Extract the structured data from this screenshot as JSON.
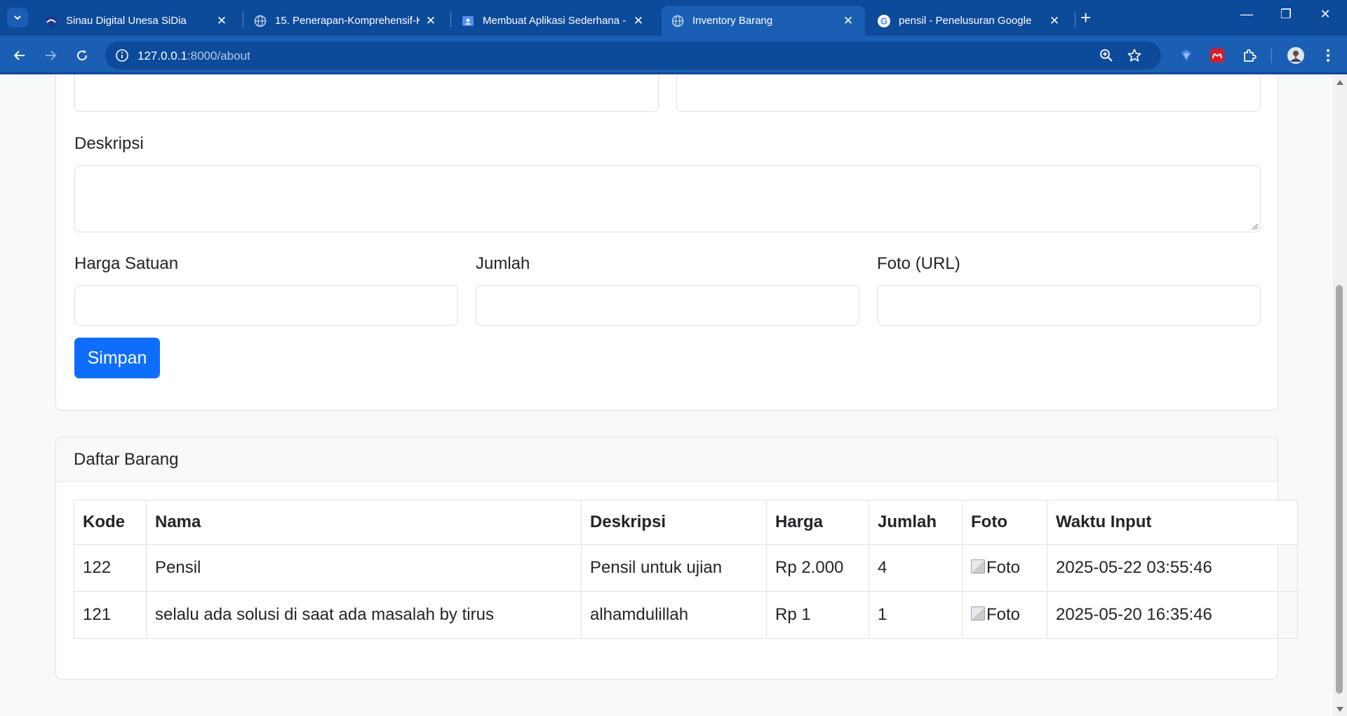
{
  "browser": {
    "tabs": [
      {
        "title": "Sinau Digital Unesa SiDia",
        "active": false
      },
      {
        "title": "15. Penerapan-Komprehensif-K",
        "active": false
      },
      {
        "title": "Membuat Aplikasi Sederhana -",
        "active": false
      },
      {
        "title": "Inventory Barang",
        "active": true
      },
      {
        "title": "pensil - Penelusuran Google",
        "active": false
      }
    ],
    "url_host": "127.0.0.1",
    "url_rest": ":8000/about"
  },
  "form": {
    "deskripsi_label": "Deskripsi",
    "harga_label": "Harga Satuan",
    "jumlah_label": "Jumlah",
    "foto_label": "Foto (URL)",
    "submit_label": "Simpan"
  },
  "list": {
    "title": "Daftar Barang",
    "headers": [
      "Kode",
      "Nama",
      "Deskripsi",
      "Harga",
      "Jumlah",
      "Foto",
      "Waktu Input"
    ],
    "rows": [
      {
        "kode": "122",
        "nama": "Pensil",
        "deskripsi": "Pensil untuk ujian",
        "harga": "Rp 2.000",
        "jumlah": "4",
        "foto_alt": "Foto",
        "waktu": "2025-05-22 03:55:46"
      },
      {
        "kode": "121",
        "nama": "selalu ada solusi di saat ada masalah by tirus",
        "deskripsi": "alhamdulillah",
        "harga": "Rp 1",
        "jumlah": "1",
        "foto_alt": "Foto",
        "waktu": "2025-05-20 16:35:46"
      }
    ]
  },
  "colors": {
    "chrome": "#1a5fb4",
    "tabstrip": "#0c4a9a",
    "primary": "#0d6efd"
  }
}
